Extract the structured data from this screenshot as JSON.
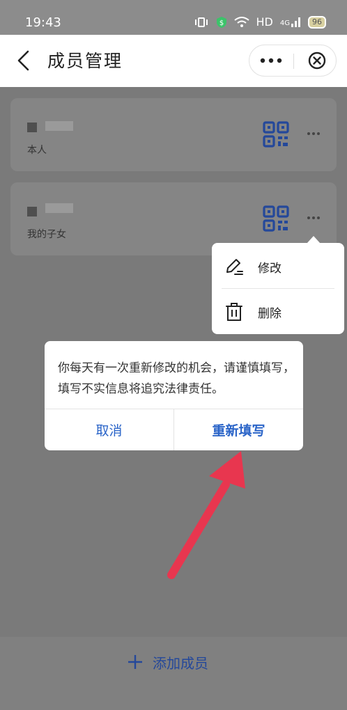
{
  "status_bar": {
    "time": "19:43",
    "network": "HD",
    "signal_label": "4G",
    "battery": "96"
  },
  "nav": {
    "title": "成员管理"
  },
  "members": [
    {
      "relation": "本人"
    },
    {
      "relation": "我的子女"
    }
  ],
  "popup_menu": {
    "items": [
      {
        "label": "修改",
        "icon": "edit-icon"
      },
      {
        "label": "删除",
        "icon": "trash-icon"
      }
    ]
  },
  "dialog": {
    "message": "你每天有一次重新修改的机会，请谨慎填写，填写不实信息将追究法律责任。",
    "cancel_label": "取消",
    "confirm_label": "重新填写"
  },
  "bottom": {
    "add_label": "添加成员"
  },
  "colors": {
    "accent": "#2a64c8",
    "annotation_arrow": "#e8364f",
    "overlay": "#7a7a7a"
  }
}
